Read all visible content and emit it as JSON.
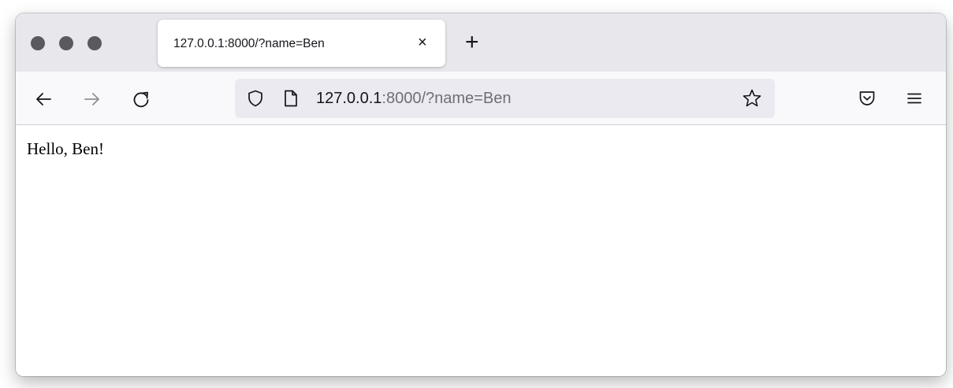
{
  "window": {
    "traffic_lights": [
      "close",
      "minimize",
      "zoom"
    ]
  },
  "tab": {
    "title": "127.0.0.1:8000/?name=Ben",
    "close_glyph": "×",
    "new_tab_glyph": "+"
  },
  "toolbar": {
    "back_icon": "back-arrow-icon",
    "forward_icon": "forward-arrow-icon",
    "reload_icon": "reload-icon",
    "url": {
      "host": "127.0.0.1",
      "rest": ":8000/?name=Ben"
    },
    "right_icons": [
      "pocket-icon",
      "menu-icon"
    ]
  },
  "page": {
    "text": "Hello, Ben!"
  }
}
